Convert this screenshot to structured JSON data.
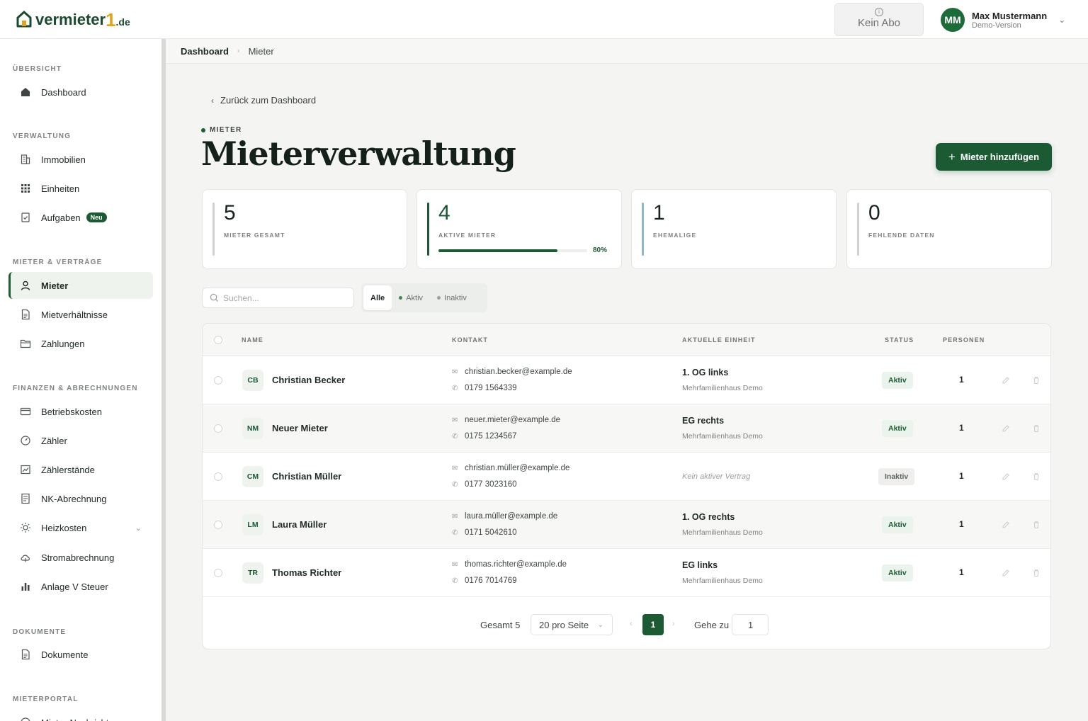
{
  "header": {
    "logo_text": "vermieter",
    "logo_one": "1",
    "logo_tld": ".de",
    "subscription_label": "Kein Abo",
    "user_initials": "MM",
    "user_name": "Max Mustermann",
    "user_subtitle": "Demo-Version"
  },
  "breadcrumb": {
    "home": "Dashboard",
    "current": "Mieter"
  },
  "sidebar": {
    "sections": [
      {
        "title": "ÜBERSICHT",
        "items": [
          {
            "label": "Dashboard",
            "icon": "home-icon"
          }
        ]
      },
      {
        "title": "VERWALTUNG",
        "items": [
          {
            "label": "Immobilien",
            "icon": "building-icon"
          },
          {
            "label": "Einheiten",
            "icon": "grid-icon"
          },
          {
            "label": "Aufgaben",
            "icon": "task-icon",
            "badge": "Neu"
          }
        ]
      },
      {
        "title": "MIETER & VERTRÄGE",
        "items": [
          {
            "label": "Mieter",
            "icon": "user-icon",
            "active": true
          },
          {
            "label": "Mietverhältnisse",
            "icon": "document-icon"
          },
          {
            "label": "Zahlungen",
            "icon": "folder-icon"
          }
        ]
      },
      {
        "title": "FINANZEN & ABRECHNUNGEN",
        "items": [
          {
            "label": "Betriebskosten",
            "icon": "credit-card-icon"
          },
          {
            "label": "Zähler",
            "icon": "gauge-icon"
          },
          {
            "label": "Zählerstände",
            "icon": "chart-icon"
          },
          {
            "label": "NK-Abrechnung",
            "icon": "receipt-icon"
          },
          {
            "label": "Heizkosten",
            "icon": "sun-icon"
          },
          {
            "label": "Stromabrechnung",
            "icon": "cloud-icon"
          },
          {
            "label": "Anlage V Steuer",
            "icon": "bar-chart-icon"
          }
        ]
      },
      {
        "title": "DOKUMENTE",
        "items": [
          {
            "label": "Dokumente",
            "icon": "document-icon"
          }
        ]
      },
      {
        "title": "MIETERPORTAL",
        "items": [
          {
            "label": "Mieter-Nachrichten",
            "icon": "message-icon"
          }
        ]
      }
    ]
  },
  "main": {
    "back_label": "Zurück zum Dashboard",
    "eyebrow": "MIETER",
    "title": "Mieterverwaltung",
    "add_button": "Mieter hinzufügen",
    "stats": [
      {
        "value": "5",
        "label": "MIETER GESAMT"
      },
      {
        "value": "4",
        "label": "AKTIVE MIETER",
        "progress": 0.8,
        "progress_label": "80%"
      },
      {
        "value": "1",
        "label": "EHEMALIGE"
      },
      {
        "value": "0",
        "label": "FEHLENDE DATEN"
      }
    ],
    "search_placeholder": "Suchen...",
    "filters": {
      "all": "Alle",
      "active": "Aktiv",
      "inactive": "Inaktiv"
    },
    "colors": {
      "accent": "#1c5a33",
      "active_dot": "#3f8a52",
      "inactive_dot": "#9aa09c"
    }
  },
  "table": {
    "columns": {
      "name": "NAME",
      "contact": "KONTAKT",
      "unit": "AKTUELLE EINHEIT",
      "status": "STATUS",
      "persons": "PERSONEN"
    },
    "rows": [
      {
        "initials": "CB",
        "name": "Christian Becker",
        "email": "christian.becker@example.de",
        "phone": "0179 1564339",
        "unit": "1. OG links",
        "property": "Mehrfamilienhaus Demo",
        "status": "Aktiv",
        "persons": "1"
      },
      {
        "initials": "NM",
        "name": "Neuer Mieter",
        "email": "neuer.mieter@example.de",
        "phone": "0175 1234567",
        "unit": "EG rechts",
        "property": "Mehrfamilienhaus Demo",
        "status": "Aktiv",
        "persons": "1"
      },
      {
        "initials": "CM",
        "name": "Christian Müller",
        "email": "christian.müller@example.de",
        "phone": "0177 3023160",
        "unit_none": "Kein aktiver Vertrag",
        "status": "Inaktiv",
        "persons": "1"
      },
      {
        "initials": "LM",
        "name": "Laura Müller",
        "email": "laura.müller@example.de",
        "phone": "0171 5042610",
        "unit": "1. OG rechts",
        "property": "Mehrfamilienhaus Demo",
        "status": "Aktiv",
        "persons": "1"
      },
      {
        "initials": "TR",
        "name": "Thomas Richter",
        "email": "thomas.richter@example.de",
        "phone": "0176 7014769",
        "unit": "EG links",
        "property": "Mehrfamilienhaus Demo",
        "status": "Aktiv",
        "persons": "1"
      }
    ]
  },
  "pagination": {
    "total": "Gesamt 5",
    "page_size": "20 pro Seite",
    "current_page": "1",
    "goto_label": "Gehe zu",
    "goto_value": "1"
  }
}
